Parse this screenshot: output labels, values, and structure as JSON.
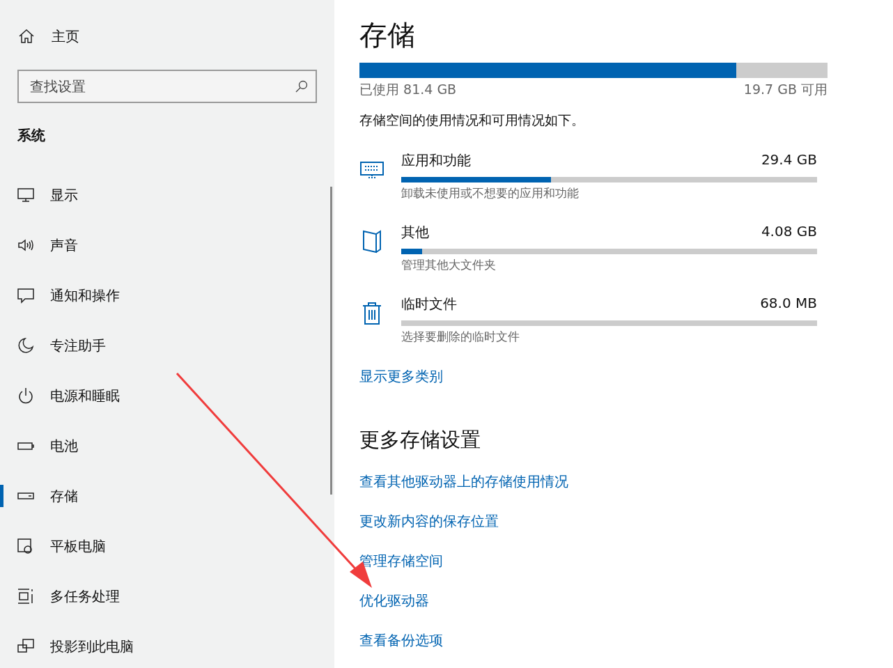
{
  "sidebar": {
    "home": "主页",
    "search": {
      "placeholder": "查找设置"
    },
    "section": "系统",
    "items": [
      {
        "label": "显示",
        "kind": "display",
        "selected": false
      },
      {
        "label": "声音",
        "kind": "sound",
        "selected": false
      },
      {
        "label": "通知和操作",
        "kind": "notification",
        "selected": false
      },
      {
        "label": "专注助手",
        "kind": "focus",
        "selected": false
      },
      {
        "label": "电源和睡眠",
        "kind": "power",
        "selected": false
      },
      {
        "label": "电池",
        "kind": "battery",
        "selected": false
      },
      {
        "label": "存储",
        "kind": "storage",
        "selected": true
      },
      {
        "label": "平板电脑",
        "kind": "tablet",
        "selected": false
      },
      {
        "label": "多任务处理",
        "kind": "multitask",
        "selected": false
      },
      {
        "label": "投影到此电脑",
        "kind": "project",
        "selected": false
      }
    ]
  },
  "main": {
    "title": "存储",
    "usage": {
      "level": 0.805,
      "used": "已使用 81.4 GB",
      "free": "19.7 GB 可用"
    },
    "description": "存储空间的使用情况和可用情况如下。",
    "categories": [
      {
        "kind": "apps",
        "name": "应用和功能",
        "size": "29.4 GB",
        "level": 0.36,
        "detail": "卸载未使用或不想要的应用和功能"
      },
      {
        "kind": "other",
        "name": "其他",
        "size": "4.08 GB",
        "level": 0.05,
        "detail": "管理其他大文件夹"
      },
      {
        "kind": "temp",
        "name": "临时文件",
        "size": "68.0 MB",
        "detail": "选择要删除的临时文件"
      }
    ],
    "more_link": "显示更多类别",
    "more_heading": "更多存储设置",
    "links": [
      "查看其他驱动器上的存储使用情况",
      "更改新内容的保存位置",
      "管理存储空间",
      "优化驱动器",
      "查看备份选项"
    ]
  }
}
